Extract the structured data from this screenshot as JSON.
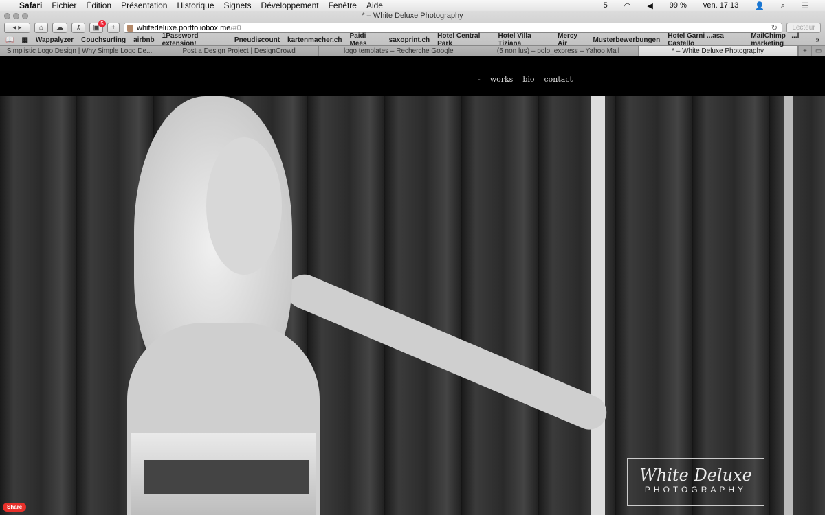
{
  "menubar": {
    "app": "Safari",
    "items": [
      "Fichier",
      "Édition",
      "Présentation",
      "Historique",
      "Signets",
      "Développement",
      "Fenêtre",
      "Aide"
    ],
    "status": {
      "notifications": "5",
      "battery": "99 %",
      "clock": "ven. 17:13"
    }
  },
  "window": {
    "title": "* – White Deluxe Photography"
  },
  "toolbar": {
    "url_host": "whitedeluxe.portfoliobox.me",
    "url_hash": "/#0",
    "badge": "5",
    "reader": "Lecteur"
  },
  "bookmarks": [
    "Wappalyzer",
    "Couchsurfing",
    "airbnb",
    "1Password extension!",
    "Pneudiscount",
    "kartenmacher.ch",
    "Paidi Mees",
    "saxoprint.ch",
    "Hotel Central Park",
    "Hotel Villa Tiziana",
    "Mercy Air",
    "Musterbewerbungen",
    "Hotel Garni ...asa Castello",
    "MailChimp –...l marketing"
  ],
  "tabs": [
    "Simplistic Logo Design | Why Simple Logo De...",
    "Post a Design Project | DesignCrowd",
    "logo templates – Recherche Google",
    "(5 non lus) – polo_express – Yahoo Mail",
    "* – White Deluxe Photography"
  ],
  "site": {
    "nav": [
      "-",
      "works",
      "bio",
      "contact"
    ],
    "logo": {
      "script": "White Deluxe",
      "sub": "PHOTOGRAPHY"
    },
    "share": "Share"
  },
  "colors": {
    "share": "#e9302a",
    "header": "#000000"
  }
}
